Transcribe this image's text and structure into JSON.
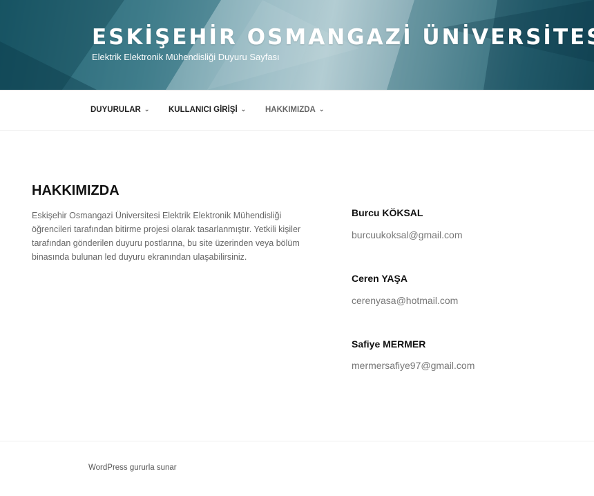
{
  "header": {
    "site_title": "ESKİŞEHİR OSMANGAZİ ÜNİVERSİTESİ",
    "site_description": "Elektrik Elektronik Mühendisliği Duyuru Sayfası"
  },
  "nav": {
    "items": [
      {
        "label": "DUYURULAR",
        "icon": "chevron-down-icon"
      },
      {
        "label": "KULLANICI GİRİŞİ",
        "icon": "chevron-down-icon"
      },
      {
        "label": "HAKKIMIZDA",
        "icon": "chevron-down-icon"
      }
    ]
  },
  "about": {
    "title": "HAKKIMIZDA",
    "text": "Eskişehir Osmangazi Üniversitesi Elektrik Elektronik Mühendisliği öğrencileri tarafından bitirme projesi olarak tasarlanmıştır. Yetkili kişiler tarafından gönderilen duyuru postlarına, bu site üzerinden veya bölüm binasında bulunan led duyuru ekranından ulaşabilirsiniz."
  },
  "contacts": [
    {
      "name": "Burcu KÖKSAL",
      "email": "burcuukoksal@gmail.com"
    },
    {
      "name": "Ceren YAŞA",
      "email": "cerenyasa@hotmail.com"
    },
    {
      "name": "Safiye MERMER",
      "email": "mermersafiye97@gmail.com"
    }
  ],
  "footer": {
    "credit": "WordPress gururla sunar"
  },
  "colors": {
    "header_dark": "#1d5e6e",
    "header_light": "#a9c6cd",
    "text_muted": "#666666"
  }
}
